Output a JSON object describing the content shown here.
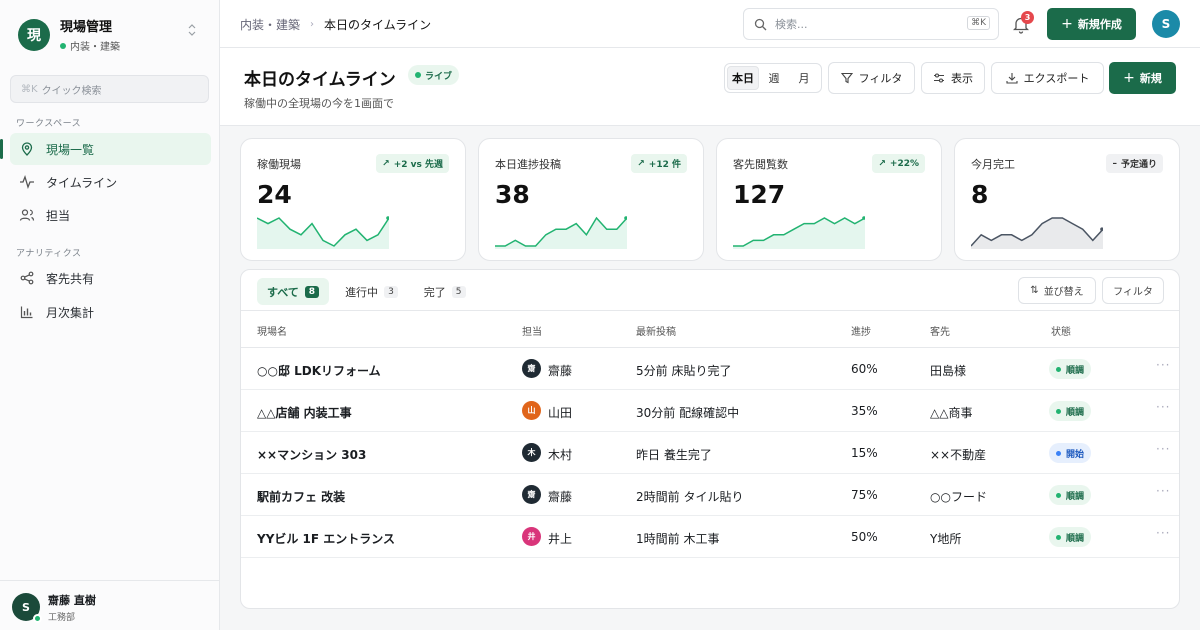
{
  "brand": {
    "logo": "現",
    "name": "現場管理",
    "sub": "内装・建築"
  },
  "sidebar": {
    "quick_search": {
      "kbd": "⌘K",
      "placeholder": "クイック検索"
    },
    "section1": "ワークスペース",
    "section2": "アナリティクス",
    "items": [
      {
        "label": "現場一覧",
        "icon": "map-pin-icon",
        "active": true
      },
      {
        "label": "タイムライン",
        "icon": "activity-icon",
        "active": false
      },
      {
        "label": "担当",
        "icon": "users-icon",
        "active": false
      },
      {
        "label": "客先共有",
        "icon": "share-icon",
        "active": false
      },
      {
        "label": "月次集計",
        "icon": "bar-chart-icon",
        "active": false
      }
    ],
    "user": {
      "avatar": "S",
      "name": "齋藤 直樹",
      "role": "工務部"
    }
  },
  "topbar": {
    "breadcrumb": [
      "内装・建築",
      "本日のタイムライン"
    ],
    "search_placeholder": "検索...",
    "search_kbd": "⌘K",
    "notifications": "3",
    "new_button": "新規作成",
    "avatar": "S"
  },
  "header": {
    "title": "本日のタイムライン",
    "live": "ライブ",
    "subtitle": "稼働中の全現場の今を1画面で",
    "periods": [
      "本日",
      "週",
      "月"
    ],
    "active_period": "本日",
    "filter": "フィルタ",
    "view": "表示",
    "export": "エクスポート",
    "new": "新規"
  },
  "kpis": [
    {
      "label": "稼働現場",
      "value": "24",
      "badge": "+2 vs 先週",
      "badge_icon": "arrow-up-right-icon",
      "trend": "up",
      "spark": [
        6,
        5,
        6,
        4,
        3,
        5,
        2,
        1,
        3,
        4,
        2,
        3,
        6
      ]
    },
    {
      "label": "本日進捗投稿",
      "value": "38",
      "badge": "+12 件",
      "badge_icon": "arrow-up-right-icon",
      "trend": "up",
      "spark": [
        1,
        1,
        2,
        1,
        1,
        3,
        4,
        4,
        5,
        3,
        6,
        4,
        4,
        6
      ]
    },
    {
      "label": "客先閲覧数",
      "value": "127",
      "badge": "+22%",
      "badge_icon": "arrow-up-right-icon",
      "trend": "up",
      "spark": [
        1,
        1,
        2,
        2,
        3,
        3,
        4,
        5,
        5,
        6,
        5,
        6,
        5,
        6
      ]
    },
    {
      "label": "今月完工",
      "value": "8",
      "badge": "予定通り",
      "badge_icon": "minus-icon",
      "trend": "neutral",
      "spark": [
        1,
        3,
        2,
        3,
        3,
        2,
        3,
        5,
        6,
        6,
        5,
        4,
        2,
        4
      ]
    }
  ],
  "colors": {
    "primary": "#1b6b4a",
    "up": "#22b371",
    "neutral": "#4b5563",
    "status_ok": "#22b371",
    "status_start": "#3b82f6"
  },
  "table": {
    "tabs": [
      {
        "label": "すべて",
        "count": "8",
        "active": true
      },
      {
        "label": "進行中",
        "count": "3",
        "active": false
      },
      {
        "label": "完了",
        "count": "5",
        "active": false
      }
    ],
    "sort": "並び替え",
    "filter": "フィルタ",
    "columns": [
      "現場名",
      "担当",
      "最新投稿",
      "進捗",
      "客先",
      "状態"
    ],
    "rows": [
      {
        "site": "○○邸 LDKリフォーム",
        "av": "齋",
        "avcolor": "#1f2a33",
        "owner": "齋藤",
        "post": "5分前 床貼り完了",
        "progress": "60%",
        "client": "田島様",
        "status": "順調",
        "status_type": "ok"
      },
      {
        "site": "△△店舗 内装工事",
        "av": "山",
        "avcolor": "#e0651b",
        "owner": "山田",
        "post": "30分前 配線確認中",
        "progress": "35%",
        "client": "△△商事",
        "status": "順調",
        "status_type": "ok"
      },
      {
        "site": "××マンション 303",
        "av": "木",
        "avcolor": "#1f2a33",
        "owner": "木村",
        "post": "昨日 養生完了",
        "progress": "15%",
        "client": "××不動産",
        "status": "開始",
        "status_type": "start"
      },
      {
        "site": "駅前カフェ 改装",
        "av": "齋",
        "avcolor": "#1f2a33",
        "owner": "齋藤",
        "post": "2時間前 タイル貼り",
        "progress": "75%",
        "client": "○○フード",
        "status": "順調",
        "status_type": "ok"
      },
      {
        "site": "YYビル 1F エントランス",
        "av": "井",
        "avcolor": "#d9357a",
        "owner": "井上",
        "post": "1時間前 木工事",
        "progress": "50%",
        "client": "Y地所",
        "status": "順調",
        "status_type": "ok"
      }
    ]
  }
}
